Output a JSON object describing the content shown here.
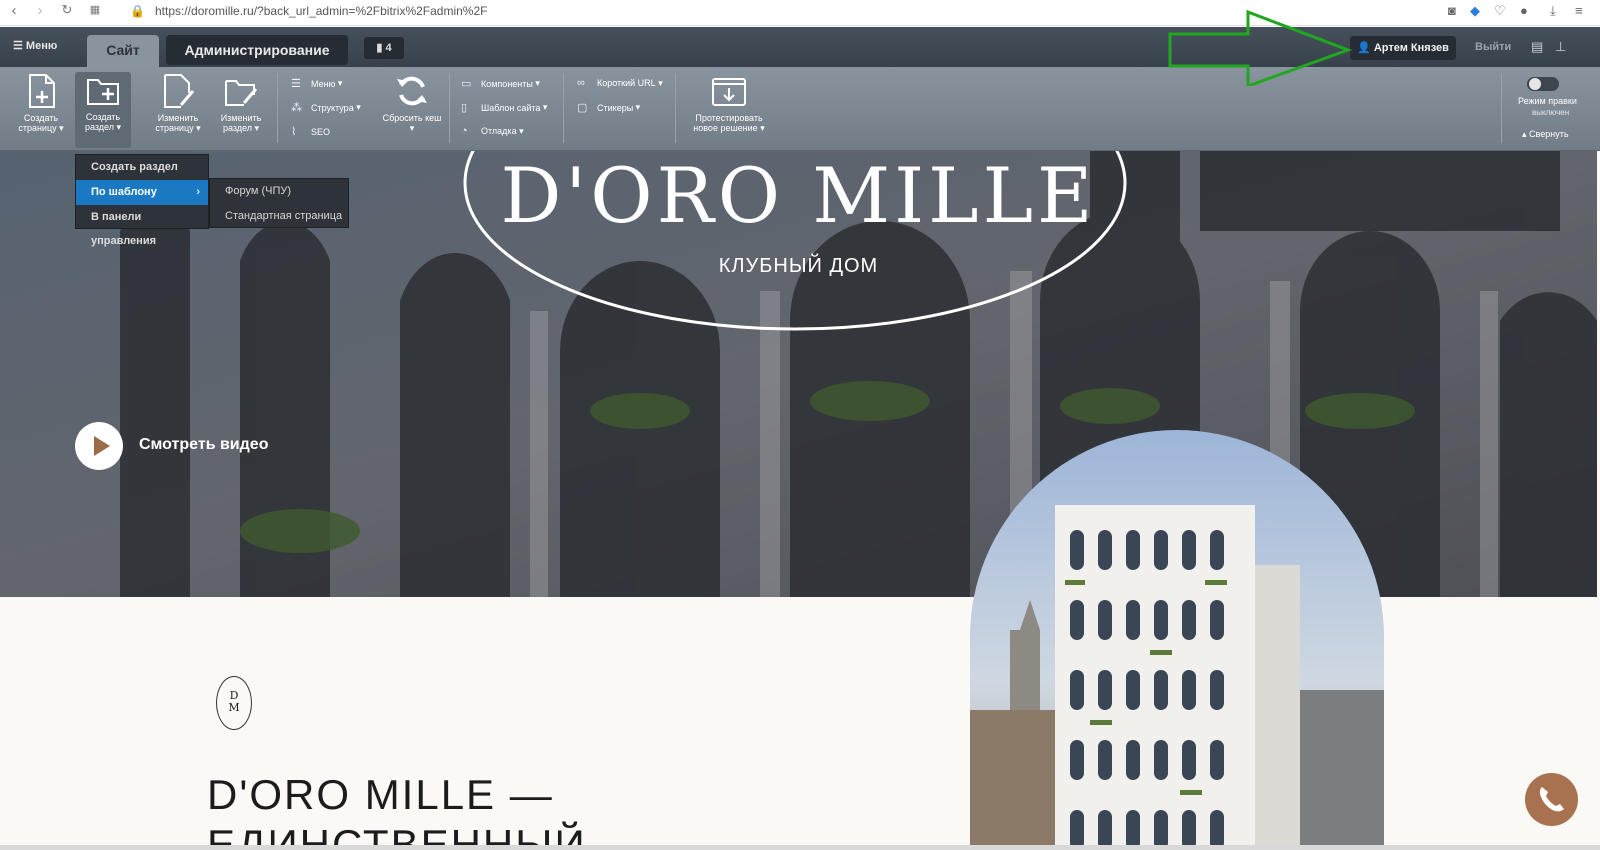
{
  "browser": {
    "url": "https://doromille.ru/?back_url_admin=%2Fbitrix%2Fadmin%2F"
  },
  "adminbar": {
    "menu_label": "Меню",
    "tab_site": "Сайт",
    "tab_admin": "Администрирование",
    "notifications_count": "4",
    "user_name": "Артем Князев",
    "logout_label": "Выйти"
  },
  "toolbar": {
    "create_page": "Создать страницу",
    "create_section": "Создать раздел",
    "edit_page": "Изменить страницу",
    "edit_section": "Изменить раздел",
    "menu": "Меню",
    "structure": "Структура",
    "seo": "SEO",
    "reset_cache": "Сбросить кеш",
    "components": "Компоненты",
    "site_template": "Шаблон сайта",
    "debug": "Отладка",
    "short_url": "Короткий URL",
    "stickers": "Стикеры",
    "test_solution": "Протестировать новое решение",
    "edit_mode_label": "Режим правки",
    "edit_mode_status": "выключен",
    "collapse": "Свернуть"
  },
  "dropdown": {
    "items": [
      "Создать раздел",
      "По шаблону",
      "В панели управления"
    ],
    "submenu": [
      "Форум (ЧПУ)",
      "Стандартная страница"
    ]
  },
  "hero": {
    "logo": "D'ORO MILLE",
    "subtitle": "КЛУБНЫЙ ДОМ",
    "video_label": "Смотреть видео"
  },
  "content": {
    "monogram_top": "D",
    "monogram_bottom": "M",
    "headline_line1": "D'ORO MILLE —",
    "headline_line2": "ЕДИНСТВЕННЫЙ"
  },
  "colors": {
    "accent_green": "#1fa81f",
    "call_button": "#a8714f",
    "selected_blue": "#1b79c4"
  }
}
